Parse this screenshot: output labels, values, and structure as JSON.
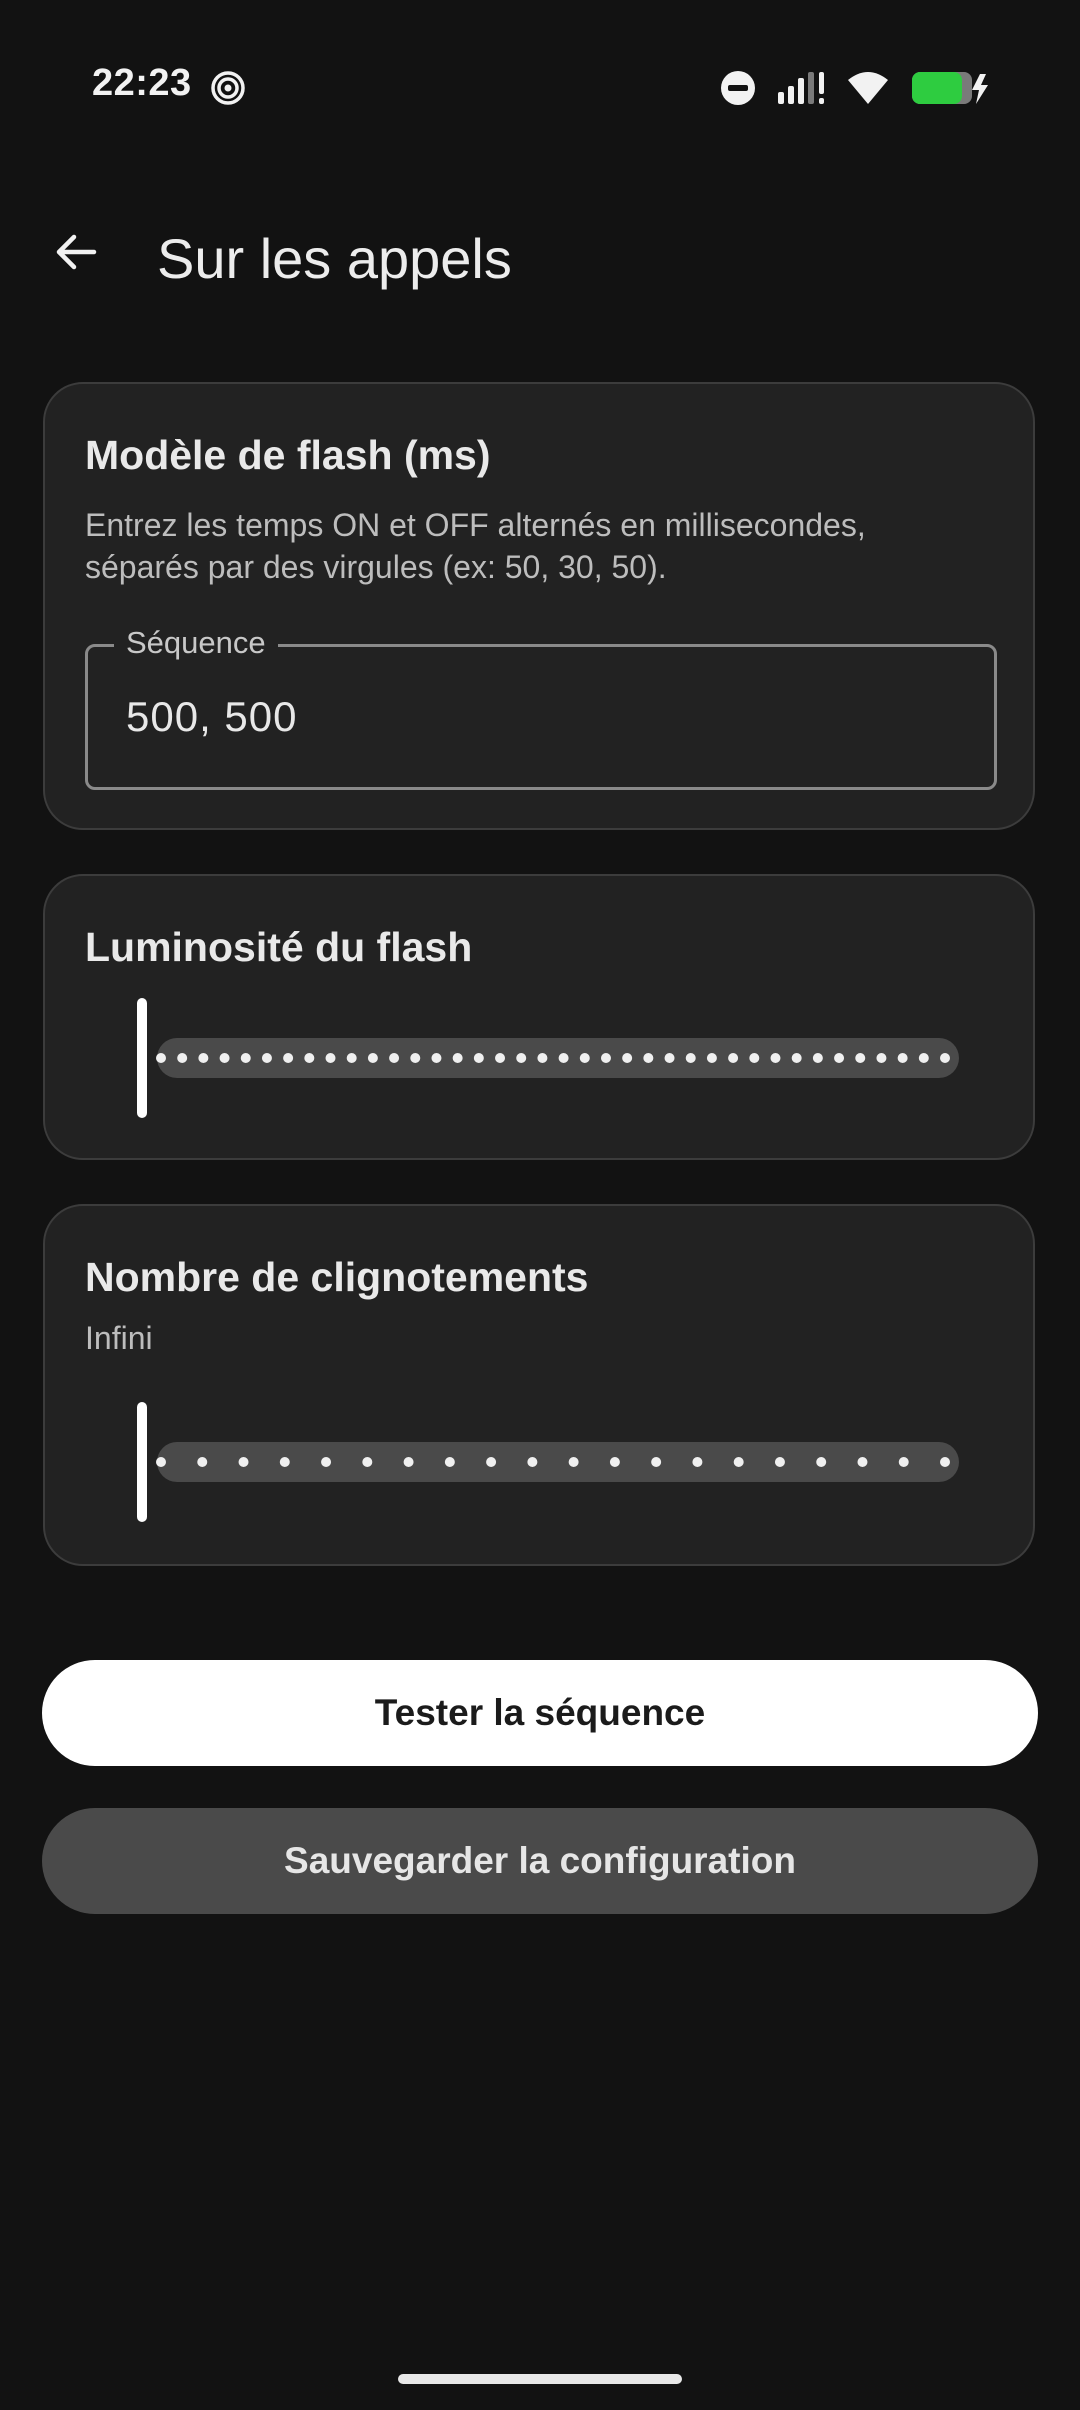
{
  "status_bar": {
    "time": "22:23",
    "icons": [
      "spiral-notification-icon",
      "do-not-disturb-icon",
      "signal-icon",
      "wifi-icon",
      "battery-charging-icon"
    ],
    "battery_color": "#2ecc40"
  },
  "app_bar": {
    "back_icon": "arrow-back-icon",
    "title": "Sur les appels"
  },
  "flash_pattern": {
    "title": "Modèle de flash (ms)",
    "description": "Entrez les temps ON et OFF alternés en millisecondes, séparés par des virgules (ex: 50, 30, 50).",
    "field_label": "Séquence",
    "field_value": "500, 500"
  },
  "brightness": {
    "title": "Luminosité du flash",
    "value_fraction": 0,
    "tick_count": 38
  },
  "blink_count": {
    "title": "Nombre de clignotements",
    "value_label": "Infini",
    "value_fraction": 0,
    "tick_count": 20
  },
  "actions": {
    "test_label": "Tester la séquence",
    "save_label": "Sauvegarder la configuration"
  },
  "colors": {
    "background": "#121212",
    "card": "#222222",
    "primary_button": "#ffffff",
    "secondary_button": "#4a4a4a"
  }
}
